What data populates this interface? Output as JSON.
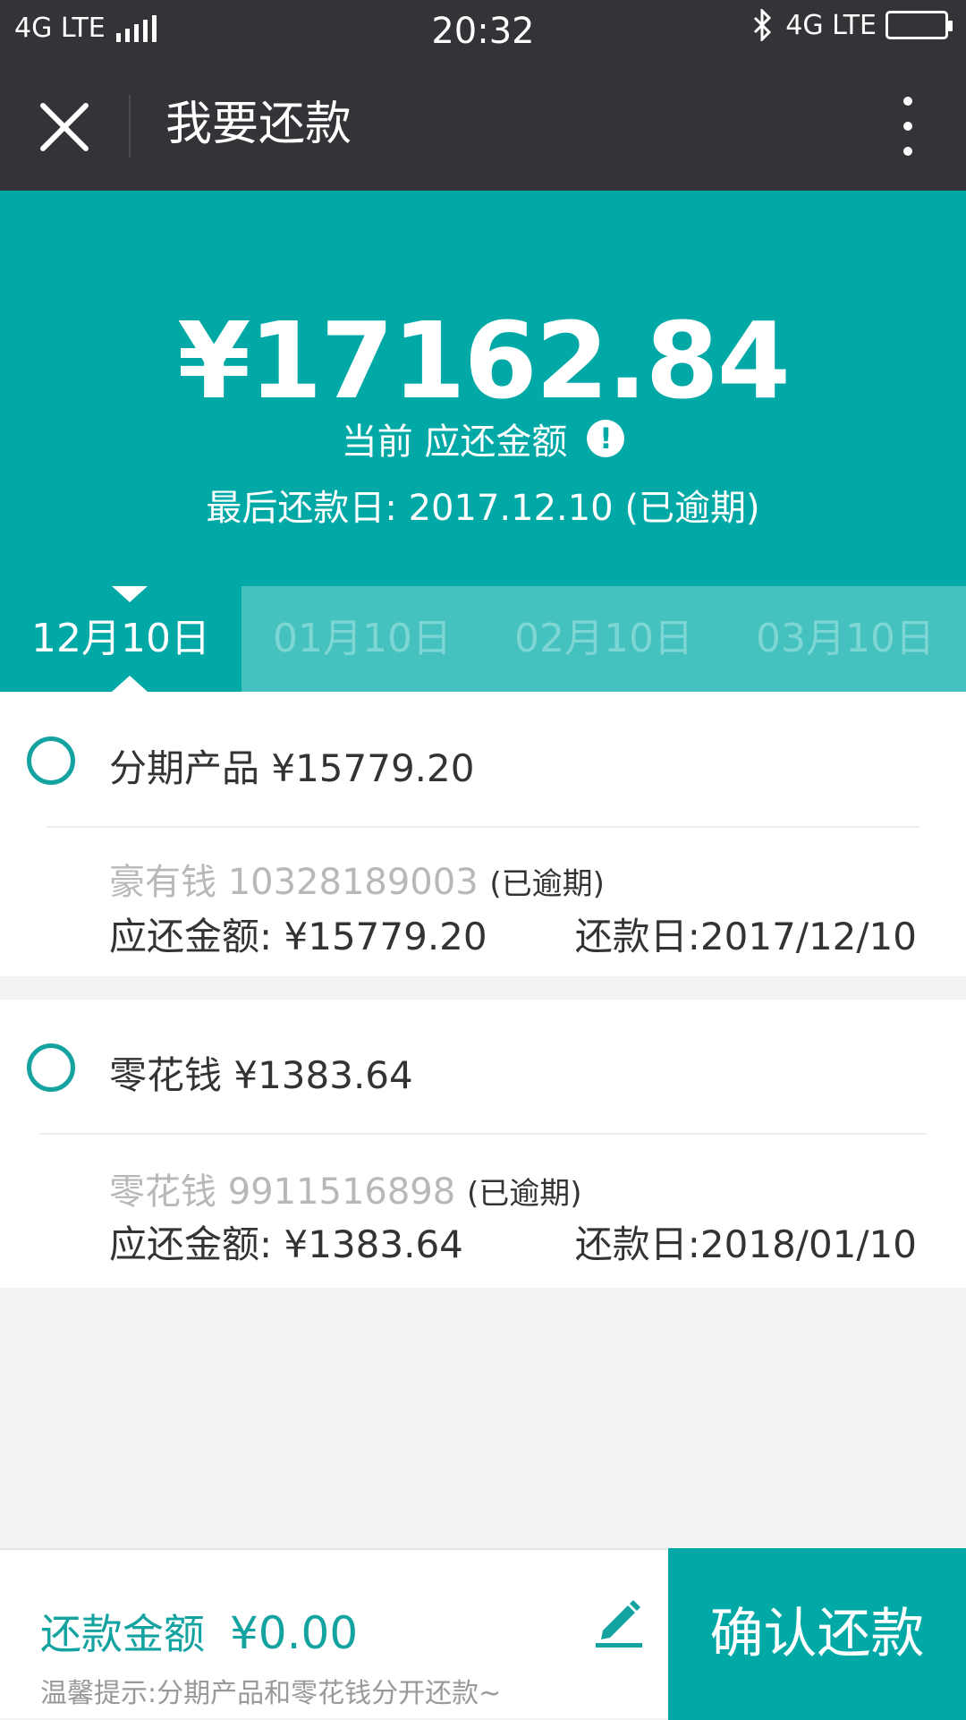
{
  "status_bar": {
    "network_left": "4G LTE",
    "time": "20:32",
    "network_right": "4G LTE"
  },
  "header": {
    "title": "我要还款"
  },
  "summary": {
    "amount": "¥17162.84",
    "amount_label": "当前 应还金额",
    "info_icon": "!",
    "due_date": "最后还款日: 2017.12.10 (已逾期)"
  },
  "tabs": [
    {
      "label": "12月10日",
      "active": true
    },
    {
      "label": "01月10日",
      "active": false
    },
    {
      "label": "02月10日",
      "active": false
    },
    {
      "label": "03月10日",
      "active": false
    }
  ],
  "loans": [
    {
      "title": "分期产品 ¥15779.20",
      "account": "豪有钱 10328189003",
      "status": "(已逾期)",
      "amount_due": "应还金额: ¥15779.20",
      "due_date": "还款日:2017/12/10",
      "selected": false
    },
    {
      "title": "零花钱 ¥1383.64",
      "account": "零花钱 9911516898",
      "status": "(已逾期)",
      "amount_due": "应还金额: ¥1383.64",
      "due_date": "还款日:2018/01/10",
      "selected": false
    }
  ],
  "footer": {
    "pay_label": "还款金额",
    "pay_amount": "¥0.00",
    "tip": "温馨提示:分期产品和零花钱分开还款~",
    "confirm_label": "确认还款"
  },
  "colors": {
    "accent": "#00a9a6",
    "header_bg": "#333437",
    "tab_bg": "#45c2bf"
  },
  "icons": [
    "close-icon",
    "more-icon",
    "info-icon",
    "edit-icon",
    "bluetooth-icon",
    "battery-icon",
    "signal-icon"
  ]
}
